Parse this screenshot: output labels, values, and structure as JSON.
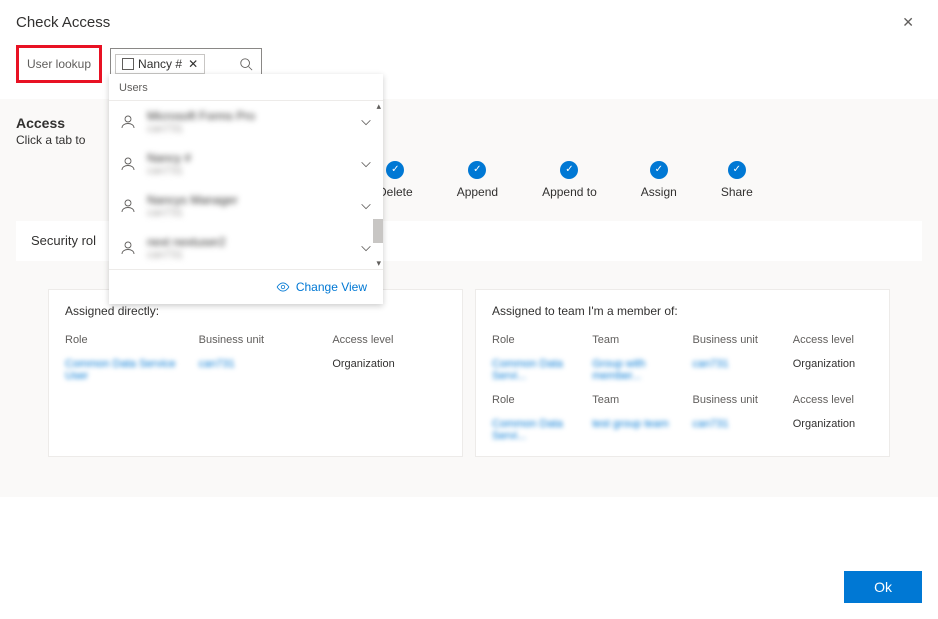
{
  "header": {
    "title": "Check Access",
    "close_symbol": "✕"
  },
  "lookup": {
    "label": "User lookup",
    "chip_text": "Nancy #",
    "chip_close": "✕"
  },
  "dropdown": {
    "section": "Users",
    "change_view": "Change View",
    "items": [
      {
        "name": "Microsoft Forms Pro",
        "sub": "can731"
      },
      {
        "name": "Nancy #",
        "sub": "can731"
      },
      {
        "name": "Nancys Manager",
        "sub": "can731"
      },
      {
        "name": "next nextuser2",
        "sub": "can731"
      }
    ]
  },
  "access": {
    "title": "Access",
    "subtitle": "Click a tab to"
  },
  "permissions": [
    {
      "label": "Delete"
    },
    {
      "label": "Append"
    },
    {
      "label": "Append to"
    },
    {
      "label": "Assign"
    },
    {
      "label": "Share"
    }
  ],
  "tab": {
    "label": "Security rol"
  },
  "card_left": {
    "title": "Assigned directly:",
    "h1": "Role",
    "h2": "Business unit",
    "h3": "Access level",
    "v1": "Common Data Service User",
    "v2": "can731",
    "v3": "Organization"
  },
  "card_right": {
    "title": "Assigned to team I'm a member of:",
    "h1": "Role",
    "h2": "Team",
    "h3": "Business unit",
    "h4": "Access level",
    "r1v1": "Common Data Servi...",
    "r1v2": "Group with member...",
    "r1v3": "can731",
    "r1v4": "Organization",
    "r2h1": "Role",
    "r2h2": "Team",
    "r2h3": "Business unit",
    "r2h4": "Access level",
    "r2v1": "Common Data Servi...",
    "r2v2": "test group team",
    "r2v3": "can731",
    "r2v4": "Organization"
  },
  "footer": {
    "ok": "Ok"
  }
}
